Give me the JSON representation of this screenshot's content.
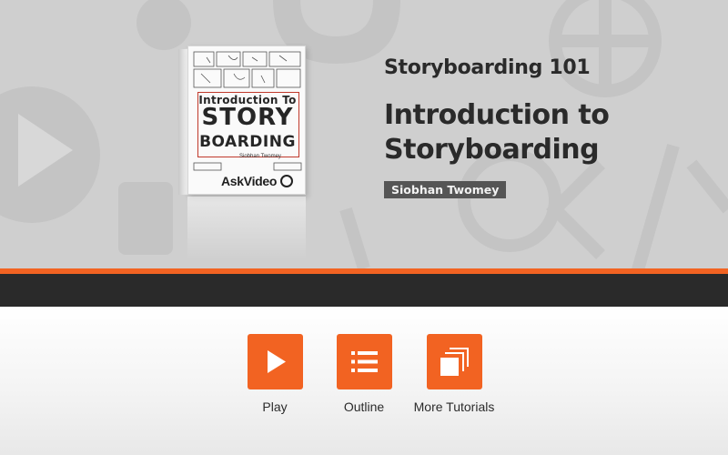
{
  "hero": {
    "series_title": "Storyboarding 101",
    "course_title_line1": "Introduction to",
    "course_title_line2": "Storyboarding",
    "author": "Siobhan Twomey",
    "product_box": {
      "title_line1": "Introduction To",
      "title_line2": "STORY",
      "title_line3": "BOARDING",
      "author": "Siobhan Twomey",
      "brand": "AskVideo"
    }
  },
  "actions": [
    {
      "label": "Play",
      "icon": "play-icon"
    },
    {
      "label": "Outline",
      "icon": "list-icon"
    },
    {
      "label": "More Tutorials",
      "icon": "stacked-pages-icon"
    }
  ],
  "colors": {
    "accent": "#f26322",
    "hero_bg": "#cfcfcf",
    "dark_band": "#2a2a2a",
    "badge_bg": "#555555",
    "title_text": "#2a2a2a"
  }
}
